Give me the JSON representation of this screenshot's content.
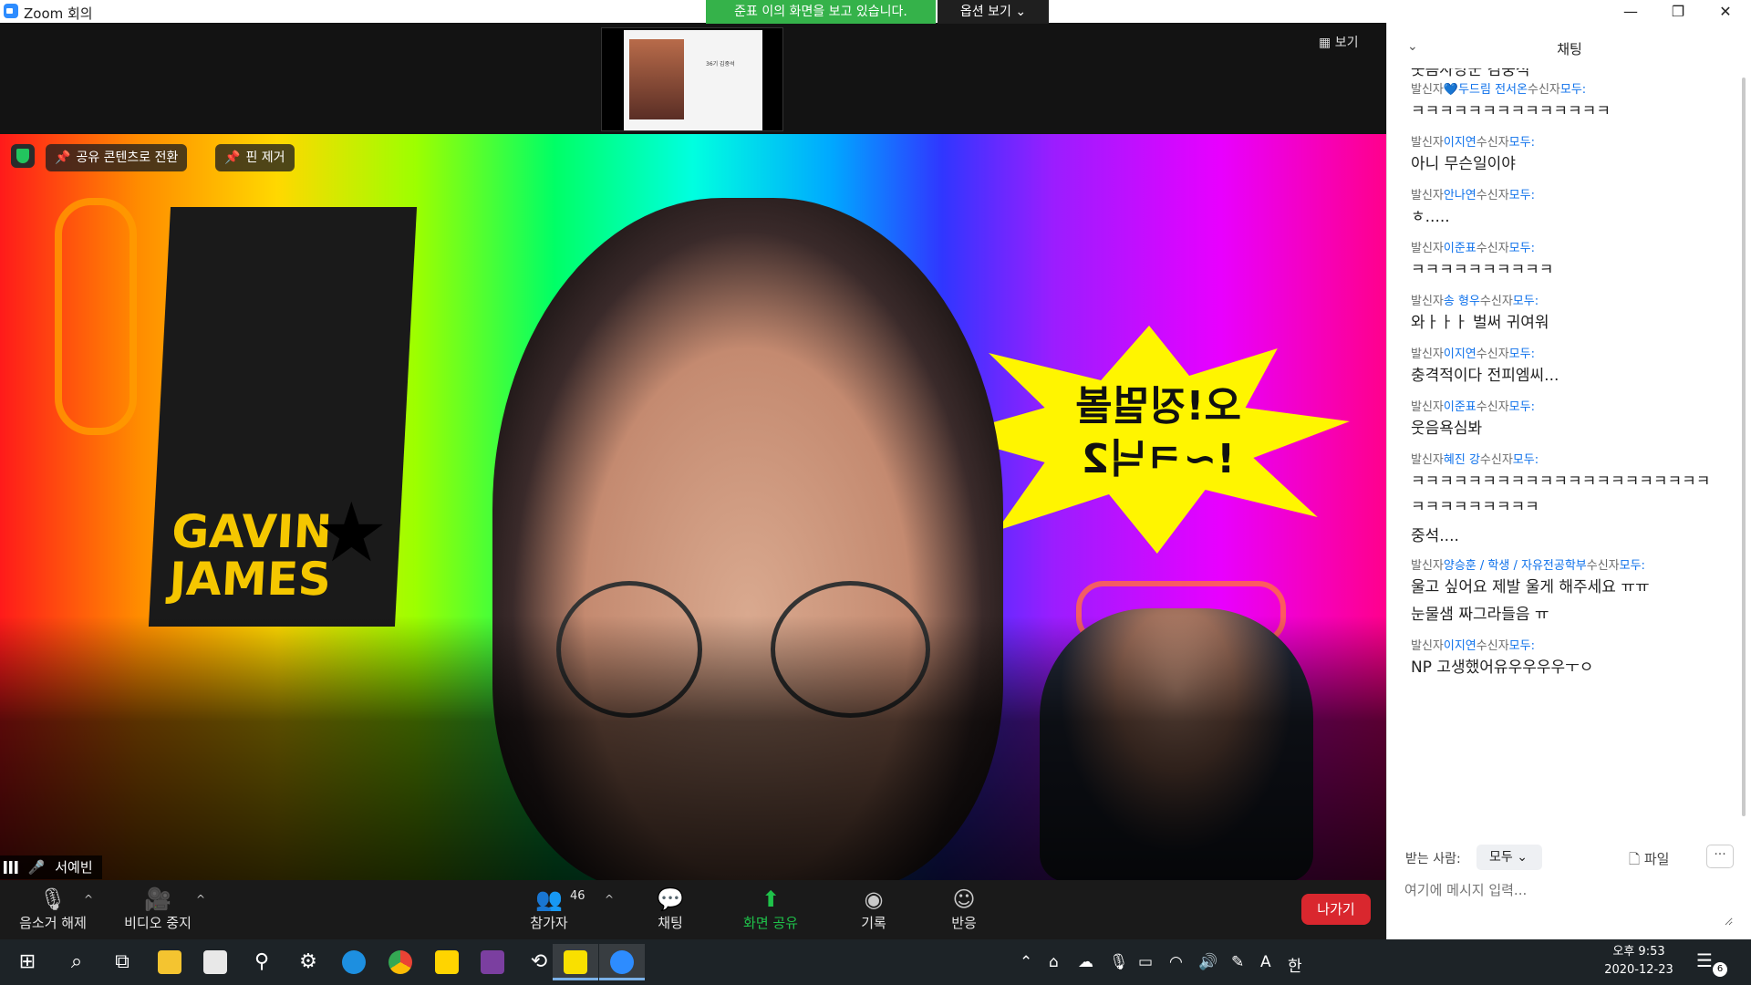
{
  "window": {
    "title": "Zoom 회의",
    "minimize": "—",
    "restore": "❐",
    "close": "✕"
  },
  "share": {
    "banner": "준표 이의 화면을 보고 있습니다.",
    "view_options": "옵션 보기 ⌄",
    "view_button": "보기"
  },
  "thumbnail": {
    "slide_text": "36기 김중석"
  },
  "video": {
    "pills": {
      "switch_label": "공유 콘텐츠로 전환",
      "unpin_label": "핀 제거"
    },
    "overlay_texts": {
      "poster": "GAVIN JAMES"
    },
    "participant_name": "서예빈"
  },
  "toolbar": {
    "unmute": "음소거 해제",
    "stop_video": "비디오 중지",
    "participants": "참가자",
    "participant_count": "46",
    "chat": "채팅",
    "share_screen": "화면 공유",
    "record": "기록",
    "reactions": "반응",
    "leave": "나가기"
  },
  "chat": {
    "title": "채팅",
    "send_to_label": "받는 사람:",
    "send_to_value": "모두",
    "file_label": "파일",
    "more_label": "···",
    "input_placeholder": "여기에 메시지 입력...",
    "messages": [
      {
        "prefix": "",
        "sender": "",
        "mid": "",
        "to": "",
        "lines": [
          "웃음사냥꾼 김중석"
        ]
      },
      {
        "prefix": "발신자",
        "sender": "💙두드림 전서온",
        "mid": "수신자",
        "to": "모두:",
        "lines": [
          "ㅋㅋㅋㅋㅋㅋㅋㅋㅋㅋㅋㅋㅋㅋ"
        ]
      },
      {
        "prefix": "발신자",
        "sender": "이지연",
        "mid": "수신자",
        "to": "모두:",
        "lines": [
          "아니 무슨일이야"
        ]
      },
      {
        "prefix": "발신자",
        "sender": "안나연",
        "mid": "수신자",
        "to": "모두:",
        "lines": [
          "ㅎ....."
        ]
      },
      {
        "prefix": "발신자",
        "sender": "이준표",
        "mid": "수신자",
        "to": "모두:",
        "lines": [
          "ㅋㅋㅋㅋㅋㅋㅋㅋㅋㅋ"
        ]
      },
      {
        "prefix": "발신자",
        "sender": "송 형우",
        "mid": "수신자",
        "to": "모두:",
        "lines": [
          "와ㅏㅏㅏ 벌써 귀여워"
        ]
      },
      {
        "prefix": "발신자",
        "sender": "이지연",
        "mid": "수신자",
        "to": "모두:",
        "lines": [
          "충격적이다 전피엠씨..."
        ]
      },
      {
        "prefix": "발신자",
        "sender": "이준표",
        "mid": "수신자",
        "to": "모두:",
        "lines": [
          "웃음욕심봐"
        ]
      },
      {
        "prefix": "발신자",
        "sender": "혜진 강",
        "mid": "수신자",
        "to": "모두:",
        "lines": [
          "ㅋㅋㅋㅋㅋㅋㅋㅋㅋㅋㅋㅋㅋㅋㅋㅋㅋㅋㅋㅋㅋ",
          "ㅋㅋㅋㅋㅋㅋㅋㅋㅋ",
          "중석...."
        ]
      },
      {
        "prefix": "발신자",
        "sender": "양승훈 / 학생 / 자유전공학부",
        "mid": "수신자",
        "to": "모두:",
        "lines": [
          "울고 싶어요 제발 울게 해주세요 ㅠㅠ",
          "눈물샘 짜그라들음 ㅠ"
        ]
      },
      {
        "prefix": "발신자",
        "sender": "이지연",
        "mid": "수신자",
        "to": "모두:",
        "lines": [
          "NP 고생했어유우우우우ㅜㅇ"
        ]
      }
    ]
  },
  "taskbar": {
    "clock_time": "오후 9:53",
    "clock_date": "2020-12-23",
    "ime_mode": "A",
    "ime_lang": "한",
    "notif_count": "6"
  },
  "colors": {
    "share_green": "#35b24a",
    "leave_red": "#d9272e",
    "chat_sender_blue": "#0e71eb"
  }
}
